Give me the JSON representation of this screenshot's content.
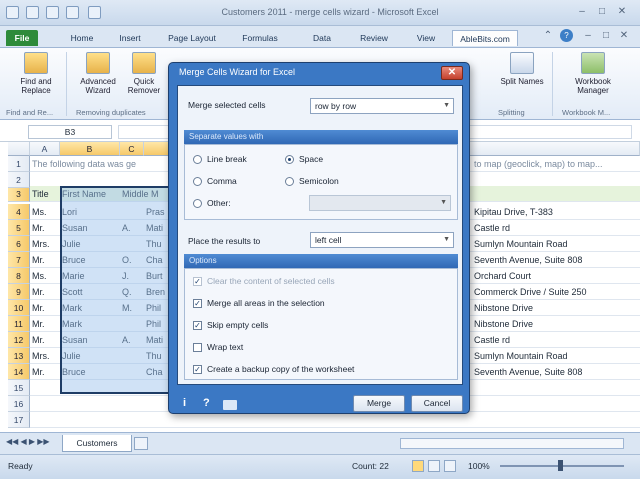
{
  "window": {
    "title": "Customers 2011 - merge cells wizard - Microsoft Excel"
  },
  "ribbon": {
    "tabs": [
      "File",
      "Home",
      "Insert",
      "Page Layout",
      "Formulas",
      "Data",
      "Review",
      "View",
      "AbleBits.com"
    ],
    "active_tab": "AbleBits.com",
    "buttons": [
      {
        "label": "Find and Replace",
        "icon": "find-replace-icon"
      },
      {
        "label": "Advanced Wizard",
        "icon": "advanced-wizard-icon"
      },
      {
        "label": "Quick Remover",
        "icon": "quick-remover-icon"
      },
      {
        "label": "Split Names",
        "icon": "split-names-icon"
      },
      {
        "label": "Workbook Manager",
        "icon": "workbook-manager-icon"
      }
    ],
    "groups": [
      "Find and Re...",
      "Removing duplicates",
      "Splitting",
      "Workbook M..."
    ]
  },
  "formula_bar": {
    "name_box": "B3"
  },
  "grid": {
    "columns": [
      "A",
      "B",
      "C"
    ],
    "note_row": "The following data was ge",
    "note_row_right": "to map (geoclick, map) to map...",
    "header_row": {
      "a": "Title",
      "b": "First Name",
      "c": "Middle M"
    },
    "rows": [
      {
        "num": "1"
      },
      {
        "num": "2"
      },
      {
        "num": "3",
        "a": "Title",
        "b": "First Name",
        "c": "Middle"
      },
      {
        "num": "4",
        "a": "Ms.",
        "b": "Lori",
        "c": "",
        "d": "Pras",
        "right": "Kipitau Drive, T-383"
      },
      {
        "num": "5",
        "a": "Mr.",
        "b": "Susan",
        "c": "A.",
        "d": "Mati",
        "right": "Castle rd"
      },
      {
        "num": "6",
        "a": "Mrs.",
        "b": "Julie",
        "c": "",
        "d": "Thu",
        "right": "Sumlyn Mountain Road"
      },
      {
        "num": "7",
        "a": "Mr.",
        "b": "Bruce",
        "c": "O.",
        "d": "Cha",
        "right": "Seventh Avenue, Suite 808"
      },
      {
        "num": "8",
        "a": "Ms.",
        "b": "Marie",
        "c": "J.",
        "d": "Burt",
        "right": "Orchard Court"
      },
      {
        "num": "9",
        "a": "Mr.",
        "b": "Scott",
        "c": "Q.",
        "d": "Bren",
        "right": "Commerck Drive / Suite 250"
      },
      {
        "num": "10",
        "a": "Mr.",
        "b": "Mark",
        "c": "M.",
        "d": "Phil",
        "right": "Nibstone Drive"
      },
      {
        "num": "11",
        "a": "Mr.",
        "b": "Mark",
        "c": "",
        "d": "Phil",
        "right": "Nibstone Drive"
      },
      {
        "num": "12",
        "a": "Mr.",
        "b": "Susan",
        "c": "A.",
        "d": "Mati",
        "right": "Castle rd"
      },
      {
        "num": "13",
        "a": "Mrs.",
        "b": "Julie",
        "c": "",
        "d": "Thu",
        "right": "Sumlyn Mountain Road"
      },
      {
        "num": "14",
        "a": "Mr.",
        "b": "Bruce",
        "c": "",
        "d": "Cha",
        "right": "Seventh Avenue, Suite 808"
      },
      {
        "num": "15"
      },
      {
        "num": "16"
      },
      {
        "num": "17"
      }
    ]
  },
  "sheet_tabs": {
    "active": "Customers"
  },
  "status_bar": {
    "ready": "Ready",
    "count": "Count: 22",
    "zoom": "100%"
  },
  "dialog": {
    "title": "Merge Cells Wizard for Excel",
    "merge_label": "Merge selected cells",
    "merge_value": "row by row",
    "separator_header": "Separate values with",
    "radios": [
      {
        "label": "Line break",
        "checked": false
      },
      {
        "label": "Space",
        "checked": true
      },
      {
        "label": "Comma",
        "checked": false
      },
      {
        "label": "Semicolon",
        "checked": false
      },
      {
        "label": "Other:",
        "checked": false
      }
    ],
    "place_label": "Place the results to",
    "place_value": "left cell",
    "options_header": "Options",
    "checks": [
      {
        "label": "Clear the content of selected cells",
        "checked": true,
        "disabled": true
      },
      {
        "label": "Merge all areas in the selection",
        "checked": true,
        "disabled": false
      },
      {
        "label": "Skip empty cells",
        "checked": true,
        "disabled": false
      },
      {
        "label": "Wrap text",
        "checked": false,
        "disabled": false
      },
      {
        "label": "Create a backup copy of the worksheet",
        "checked": true,
        "disabled": false
      }
    ],
    "merge_button": "Merge",
    "cancel_button": "Cancel",
    "footer_icons": [
      "info-icon",
      "help-icon",
      "email-icon"
    ]
  },
  "colors": {
    "selection": "#96beeb",
    "dialog_frame": "#3b78c4",
    "file_tab": "#2e8b3a"
  }
}
